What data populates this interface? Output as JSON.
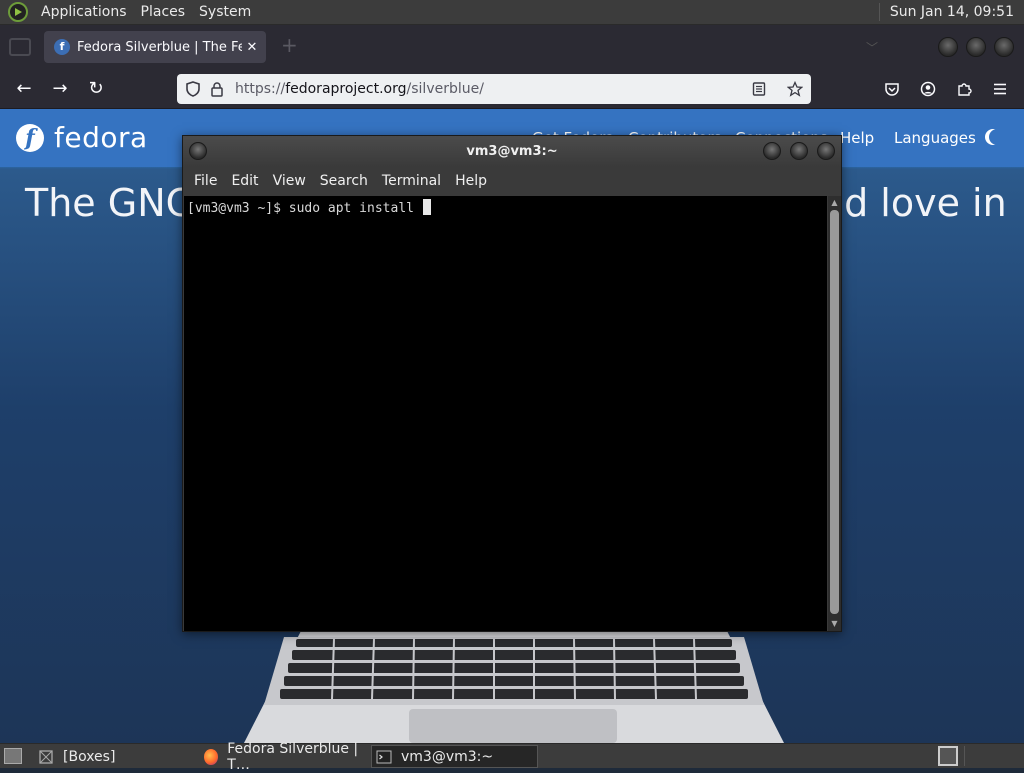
{
  "top_panel": {
    "menus": [
      "Applications",
      "Places",
      "System"
    ],
    "clock": "Sun Jan 14, 09:51"
  },
  "browser": {
    "tab": {
      "title": "Fedora Silverblue | The Fedo",
      "favicon": "fedora-icon",
      "close": "✕"
    },
    "new_tab": "+",
    "url_prefix": "https://",
    "url_domain": "fedoraproject.org",
    "url_path": "/silverblue/",
    "icons": [
      "back-icon",
      "forward-icon",
      "reload-icon",
      "shield-icon",
      "lock-icon",
      "reader-view-icon",
      "bookmark-star-icon",
      "pocket-icon",
      "account-icon",
      "extensions-icon",
      "menu-icon"
    ]
  },
  "site": {
    "logo_text": "fedora",
    "nav": [
      "Get Fedora",
      "Contributors",
      "Connections",
      "Help",
      "Languages"
    ],
    "hero_left": "The GNC",
    "hero_right": "nd love in"
  },
  "terminal": {
    "title": "vm3@vm3:~",
    "menu": [
      "File",
      "Edit",
      "View",
      "Search",
      "Terminal",
      "Help"
    ],
    "prompt": "[vm3@vm3 ~]$ sudo apt install "
  },
  "taskbar": {
    "items": [
      {
        "label": "[Boxes]",
        "icon": "boxes-icon"
      },
      {
        "label": "Fedora Silverblue | T…",
        "icon": "firefox-icon"
      },
      {
        "label": "vm3@vm3:~",
        "icon": "terminal-icon"
      }
    ]
  },
  "colors": {
    "fedora_blue": "#3573c1",
    "panel": "#3c3c3c",
    "terminal_bg": "#000000"
  }
}
